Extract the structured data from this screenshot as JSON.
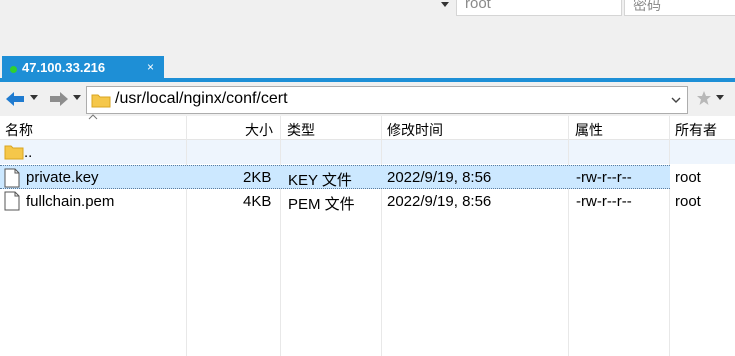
{
  "login": {
    "user_value": "root",
    "password_placeholder": "密码"
  },
  "tab": {
    "label": "47.100.33.216",
    "close_glyph": "×",
    "status_color": "#2fd02f"
  },
  "pathbar": {
    "path": "/usr/local/nginx/conf/cert"
  },
  "columns": {
    "name": "名称",
    "size": "大小",
    "type": "类型",
    "modified": "修改时间",
    "attributes": "属性",
    "owner": "所有者"
  },
  "files": [
    {
      "name": "..",
      "size": "",
      "type": "",
      "modified": "",
      "attributes": "",
      "owner": "",
      "icon": "folder-icon"
    },
    {
      "name": "private.key",
      "size": "2KB",
      "type": "KEY 文件",
      "modified": "2022/9/19, 8:56",
      "attributes": "-rw-r--r--",
      "owner": "root",
      "icon": "file-icon",
      "selected": true
    },
    {
      "name": "fullchain.pem",
      "size": "4KB",
      "type": "PEM 文件",
      "modified": "2022/9/19, 8:56",
      "attributes": "-rw-r--r--",
      "owner": "root",
      "icon": "file-icon"
    }
  ],
  "colors": {
    "tab_accent": "#1e8fd6",
    "selection": "#cce8ff",
    "nav_arrow": "#1f7bd0"
  }
}
